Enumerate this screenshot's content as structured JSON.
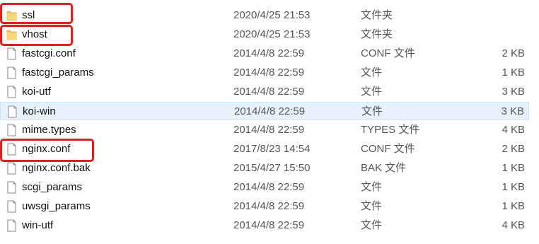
{
  "files": [
    {
      "name": "ssl",
      "date": "2020/4/25 21:53",
      "type": "文件夹",
      "size": "",
      "icon": "folder-icon",
      "selected": false,
      "highlighted": true
    },
    {
      "name": "vhost",
      "date": "2020/4/25 21:53",
      "type": "文件夹",
      "size": "",
      "icon": "folder-icon",
      "selected": false,
      "highlighted": true
    },
    {
      "name": "fastcgi.conf",
      "date": "2014/4/8 22:59",
      "type": "CONF 文件",
      "size": "2 KB",
      "icon": "file-icon",
      "selected": false,
      "highlighted": false
    },
    {
      "name": "fastcgi_params",
      "date": "2014/4/8 22:59",
      "type": "文件",
      "size": "1 KB",
      "icon": "file-icon",
      "selected": false,
      "highlighted": false
    },
    {
      "name": "koi-utf",
      "date": "2014/4/8 22:59",
      "type": "文件",
      "size": "3 KB",
      "icon": "file-icon",
      "selected": false,
      "highlighted": false
    },
    {
      "name": "koi-win",
      "date": "2014/4/8 22:59",
      "type": "文件",
      "size": "3 KB",
      "icon": "file-icon",
      "selected": true,
      "highlighted": false
    },
    {
      "name": "mime.types",
      "date": "2014/4/8 22:59",
      "type": "TYPES 文件",
      "size": "4 KB",
      "icon": "file-icon",
      "selected": false,
      "highlighted": false
    },
    {
      "name": "nginx.conf",
      "date": "2017/8/23 14:54",
      "type": "CONF 文件",
      "size": "2 KB",
      "icon": "file-icon",
      "selected": false,
      "highlighted": true
    },
    {
      "name": "nginx.conf.bak",
      "date": "2015/4/27 15:50",
      "type": "BAK 文件",
      "size": "1 KB",
      "icon": "file-icon",
      "selected": false,
      "highlighted": false
    },
    {
      "name": "scgi_params",
      "date": "2014/4/8 22:59",
      "type": "文件",
      "size": "1 KB",
      "icon": "file-icon",
      "selected": false,
      "highlighted": false
    },
    {
      "name": "uwsgi_params",
      "date": "2014/4/8 22:59",
      "type": "文件",
      "size": "1 KB",
      "icon": "file-icon",
      "selected": false,
      "highlighted": false
    },
    {
      "name": "win-utf",
      "date": "2014/4/8 22:59",
      "type": "文件",
      "size": "4 KB",
      "icon": "file-icon",
      "selected": false,
      "highlighted": false
    }
  ],
  "colors": {
    "highlight": "#e02020",
    "selection": "#e6f1fb",
    "folder": "#f2c45a"
  }
}
